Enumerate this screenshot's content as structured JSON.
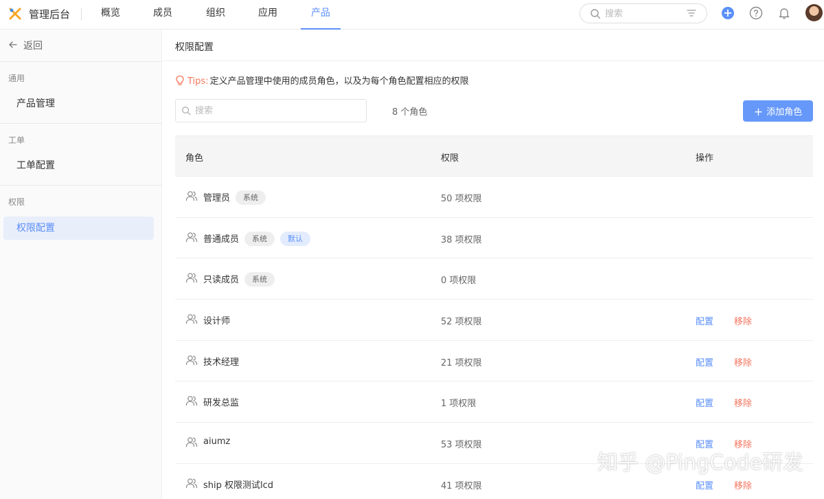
{
  "app": {
    "title": "管理后台"
  },
  "nav": {
    "tabs": [
      {
        "label": "概览"
      },
      {
        "label": "成员"
      },
      {
        "label": "组织"
      },
      {
        "label": "应用"
      },
      {
        "label": "产品",
        "active": true
      }
    ]
  },
  "topbar": {
    "search_placeholder": "搜索"
  },
  "sidebar": {
    "back_label": "返回",
    "groups": [
      {
        "label": "通用",
        "items": [
          {
            "label": "产品管理"
          }
        ]
      },
      {
        "label": "工单",
        "items": [
          {
            "label": "工单配置"
          }
        ]
      },
      {
        "label": "权限",
        "items": [
          {
            "label": "权限配置",
            "active": true
          }
        ]
      }
    ]
  },
  "main": {
    "title": "权限配置",
    "tips_label": "Tips:",
    "tips_text": "定义产品管理中使用的成员角色，以及为每个角色配置相应的权限",
    "search_placeholder": "搜索",
    "role_count": "8 个角色",
    "add_button": "添加角色",
    "table": {
      "headers": {
        "role": "角色",
        "permission": "权限",
        "action": "操作"
      },
      "configure_label": "配置",
      "remove_label": "移除",
      "rows": [
        {
          "name": "管理员",
          "tags": [
            "系统"
          ],
          "permissions": "50 项权限",
          "actions": false
        },
        {
          "name": "普通成员",
          "tags": [
            "系统",
            "默认"
          ],
          "permissions": "38 项权限",
          "actions": false
        },
        {
          "name": "只读成员",
          "tags": [
            "系统"
          ],
          "permissions": "0 项权限",
          "actions": false
        },
        {
          "name": "设计师",
          "tags": [],
          "permissions": "52 项权限",
          "actions": true
        },
        {
          "name": "技术经理",
          "tags": [],
          "permissions": "21 项权限",
          "actions": true
        },
        {
          "name": "研发总监",
          "tags": [],
          "permissions": "1 项权限",
          "actions": true
        },
        {
          "name": "aiumz",
          "tags": [],
          "permissions": "53 项权限",
          "actions": true
        },
        {
          "name": "ship 权限测试lcd",
          "tags": [],
          "permissions": "41 项权限",
          "actions": true
        }
      ]
    }
  },
  "watermark": "知乎 @PingCode研发",
  "colors": {
    "accent": "#5b8ff9",
    "danger": "#f5735d",
    "tips": "#f5785a"
  }
}
